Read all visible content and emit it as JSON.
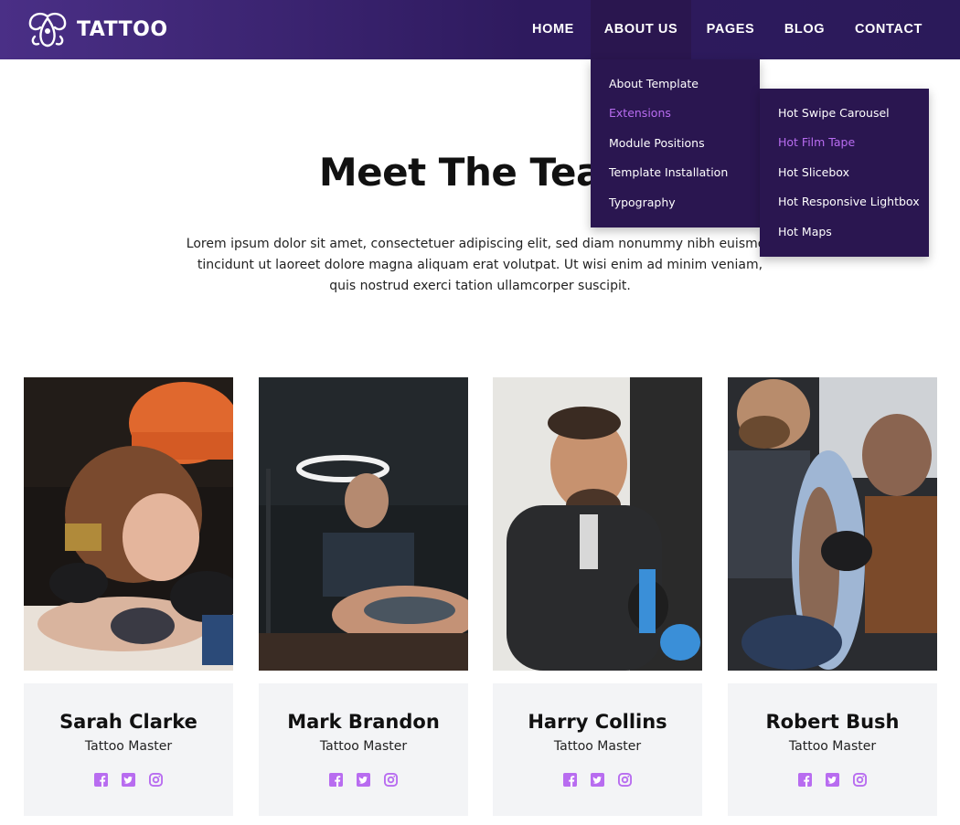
{
  "brand": {
    "name": "TATTOO",
    "accent": "#b86cf0",
    "nav_bg": "#3b2470",
    "dropdown_bg": "#2a1650"
  },
  "nav": [
    {
      "label": "HOME",
      "active": false
    },
    {
      "label": "ABOUT US",
      "active": true
    },
    {
      "label": "PAGES",
      "active": false
    },
    {
      "label": "BLOG",
      "active": false
    },
    {
      "label": "CONTACT",
      "active": false
    }
  ],
  "about_menu": [
    {
      "label": "About Template"
    },
    {
      "label": "Extensions",
      "highlighted": true
    },
    {
      "label": "Module Positions"
    },
    {
      "label": "Template Installation"
    },
    {
      "label": "Typography"
    }
  ],
  "extensions_menu": [
    {
      "label": "Hot Swipe Carousel"
    },
    {
      "label": "Hot Film Tape",
      "highlighted": true
    },
    {
      "label": "Hot Slicebox"
    },
    {
      "label": "Hot Responsive Lightbox"
    },
    {
      "label": "Hot Maps"
    }
  ],
  "section": {
    "title": "Meet The Team",
    "intro_lines": [
      "Lorem ipsum dolor sit amet, consectetuer adipiscing elit, sed diam nonummy nibh euismod",
      "tincidunt ut laoreet dolore magna aliquam erat volutpat. Ut wisi enim ad minim veniam,",
      "quis nostrud exerci tation ullamcorper suscipit."
    ]
  },
  "team": [
    {
      "name": "Sarah Clarke",
      "role": "Tattoo Master"
    },
    {
      "name": "Mark Brandon",
      "role": "Tattoo Master"
    },
    {
      "name": "Harry Collins",
      "role": "Tattoo Master"
    },
    {
      "name": "Robert Bush",
      "role": "Tattoo Master"
    }
  ],
  "social_icons": [
    "facebook-icon",
    "twitter-icon",
    "instagram-icon"
  ]
}
